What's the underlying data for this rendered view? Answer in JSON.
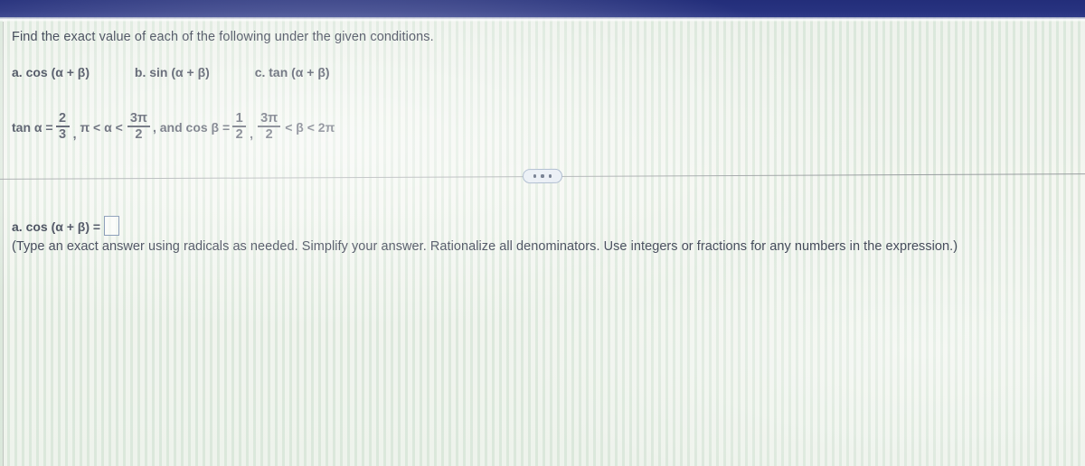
{
  "topbar": {
    "color": "#27327f"
  },
  "problem": {
    "prompt": "Find the exact value of each of the following under the given conditions.",
    "parts": [
      {
        "id": "a",
        "label": "a. cos (α + β)"
      },
      {
        "id": "b",
        "label": "b. sin (α + β)"
      },
      {
        "id": "c",
        "label": "c. tan (α + β)"
      }
    ],
    "conditions": {
      "tan_alpha_label": "tan α =",
      "tan_alpha_num": "2",
      "tan_alpha_den": "3",
      "alpha_range_left": "π < α <",
      "alpha_range_num": "3π",
      "alpha_range_den": "2",
      "connector": ", and cos β =",
      "cos_beta_num": "1",
      "cos_beta_den": "2",
      "beta_range_num": "3π",
      "beta_range_den": "2",
      "beta_range_right": "< β < 2π",
      "comma1": ",",
      "comma2": ","
    }
  },
  "divider": {
    "more_label": "•••"
  },
  "answer": {
    "label": "a. cos (α + β) =",
    "value": "",
    "placeholder": "",
    "hint": "(Type an exact answer using radicals as needed. Simplify your answer. Rationalize all denominators. Use integers or fractions for any numbers in the expression.)"
  }
}
